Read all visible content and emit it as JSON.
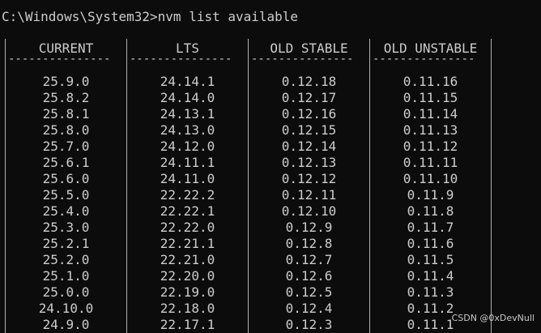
{
  "terminal": {
    "prompt": "C:\\Windows\\System32>nvm list available",
    "columns": [
      {
        "header": "CURRENT",
        "separator": "---------------",
        "values": [
          "25.9.0",
          "25.8.2",
          "25.8.1",
          "25.8.0",
          "25.7.0",
          "25.6.1",
          "25.6.0",
          "25.5.0",
          "25.4.0",
          "25.3.0",
          "25.2.1",
          "25.2.0",
          "25.1.0",
          "25.0.0",
          "24.10.0",
          "24.9.0"
        ]
      },
      {
        "header": "LTS",
        "separator": "---------------",
        "values": [
          "24.14.1",
          "24.14.0",
          "24.13.1",
          "24.13.0",
          "24.12.0",
          "24.11.1",
          "24.11.0",
          "22.22.2",
          "22.22.1",
          "22.22.0",
          "22.21.1",
          "22.21.0",
          "22.20.0",
          "22.19.0",
          "22.18.0",
          "22.17.1"
        ]
      },
      {
        "header": "OLD STABLE",
        "separator": "---------------",
        "values": [
          "0.12.18",
          "0.12.17",
          "0.12.16",
          "0.12.15",
          "0.12.14",
          "0.12.13",
          "0.12.12",
          "0.12.11",
          "0.12.10",
          "0.12.9",
          "0.12.8",
          "0.12.7",
          "0.12.6",
          "0.12.5",
          "0.12.4",
          "0.12.3"
        ]
      },
      {
        "header": "OLD UNSTABLE",
        "separator": "---------------",
        "values": [
          "0.11.16",
          "0.11.15",
          "0.11.14",
          "0.11.13",
          "0.11.12",
          "0.11.11",
          "0.11.10",
          "0.11.9",
          "0.11.8",
          "0.11.7",
          "0.11.6",
          "0.11.5",
          "0.11.4",
          "0.11.3",
          "0.11.2",
          "0.11.1"
        ]
      }
    ]
  },
  "watermark": "CSDN @0xDevNull",
  "colors": {
    "background": "#0c0c0c",
    "text": "#cccccc"
  }
}
